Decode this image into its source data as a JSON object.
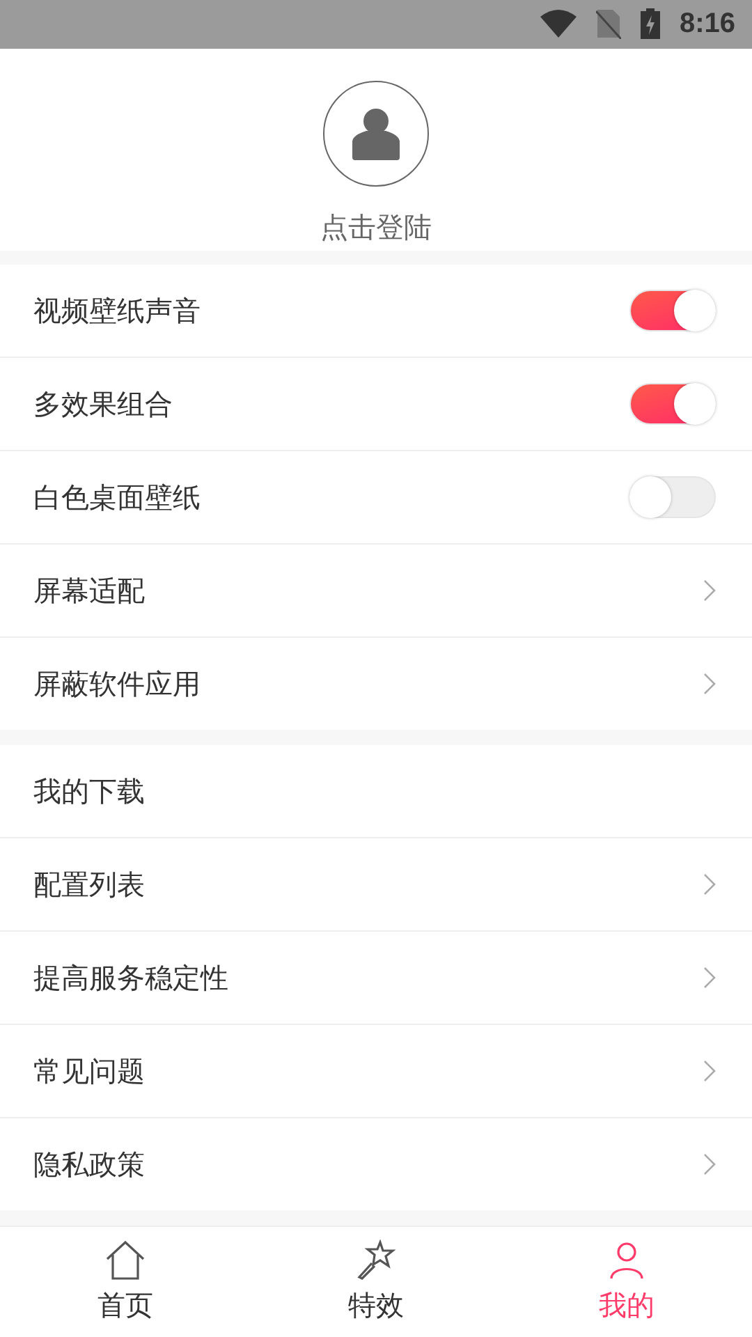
{
  "status_bar": {
    "time": "8:16"
  },
  "profile": {
    "login_label": "点击登陆"
  },
  "sections": [
    {
      "items": [
        {
          "label": "视频壁纸声音",
          "kind": "toggle",
          "on": true
        },
        {
          "label": "多效果组合",
          "kind": "toggle",
          "on": true
        },
        {
          "label": "白色桌面壁纸",
          "kind": "toggle",
          "on": false
        },
        {
          "label": "屏幕适配",
          "kind": "link"
        },
        {
          "label": "屏蔽软件应用",
          "kind": "link"
        }
      ]
    },
    {
      "items": [
        {
          "label": "我的下载",
          "kind": "plain"
        },
        {
          "label": "配置列表",
          "kind": "link"
        },
        {
          "label": "提高服务稳定性",
          "kind": "link"
        },
        {
          "label": "常见问题",
          "kind": "link"
        },
        {
          "label": "隐私政策",
          "kind": "link"
        }
      ]
    }
  ],
  "tab_bar": [
    {
      "label": "首页",
      "selected": false
    },
    {
      "label": "特效",
      "selected": false
    },
    {
      "label": "我的",
      "selected": true
    }
  ]
}
